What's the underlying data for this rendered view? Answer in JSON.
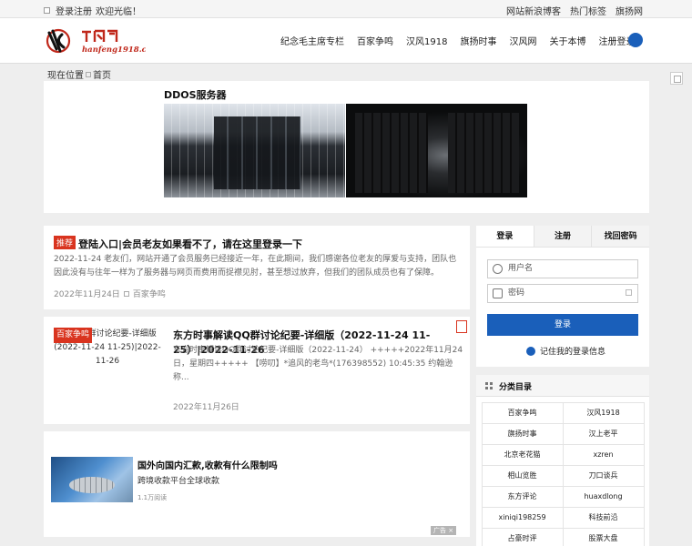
{
  "topbar": {
    "login_register": "登录注册",
    "welcome": "欢迎光临！",
    "links": [
      "网站新浪博客",
      "热门标签",
      "旗扬网"
    ]
  },
  "header": {
    "logo_alt": "汉风网 hanfeng1918.com",
    "nav": [
      "纪念毛主席专栏",
      "百家争鸣",
      "汉风1918",
      "旗扬时事",
      "汉风网",
      "关于本博",
      "注册登录"
    ]
  },
  "breadcrumb": {
    "prefix": "现在位置",
    "home": "首页"
  },
  "banner": {
    "title": "DDOS服务器"
  },
  "posts": [
    {
      "tag": "推荐",
      "title": "登陆入口|会员老友如果看不了，请在这里登录一下",
      "excerpt": "2022-11-24 老友们，网站开通了会员服务已经接近一年，在此期间，我们感谢各位老友的厚爱与支持，团队也因此没有与往年一样为了服务器与网页而费用而捉襟见肘，甚至想过放弃，但我们的团队成员也有了保障。",
      "date": "2022年11月24日",
      "category": "百家争鸣"
    },
    {
      "tag": "百家争鸣",
      "thumb_text": "解读QQ群讨论纪要-详细版(2022-11-24 11-25)|2022-11-26",
      "title": "东方时事解读QQ群讨论纪要-详细版（2022-11-24 11-25）|2022-11-26",
      "excerpt": "东方时事解读QQ群讨论纪要-详细版（2022-11-24） +++++2022年11月24日，星期四+++++ 【唠叨】*追风的老鸟*(176398552) 10:45:35 约翰逊称...",
      "date": "2022年11月26日"
    }
  ],
  "ad": {
    "title": "国外向国内汇款,收款有什么限制吗",
    "subtitle": "跨境收款平台全球收款",
    "reads": "1.1万阅读",
    "label": "广告 ×"
  },
  "login": {
    "tabs": [
      "登录",
      "注册",
      "找回密码"
    ],
    "username_placeholder": "用户名",
    "password_placeholder": "密码",
    "submit": "登录",
    "remember": "记住我的登录信息"
  },
  "categories": {
    "title": "分类目录",
    "items": [
      "百家争鸣",
      "汉风1918",
      "旗扬时事",
      "汉上老平",
      "北京老花猫",
      "xzren",
      "相山览胜",
      "刀口谈兵",
      "东方评论",
      "huaxdlong",
      "xiniqi198259",
      "科技前沿",
      "占豪时评",
      "股票大盘"
    ]
  },
  "colors": {
    "accent_blue": "#1a5fba",
    "tag_red": "#d9341f"
  }
}
